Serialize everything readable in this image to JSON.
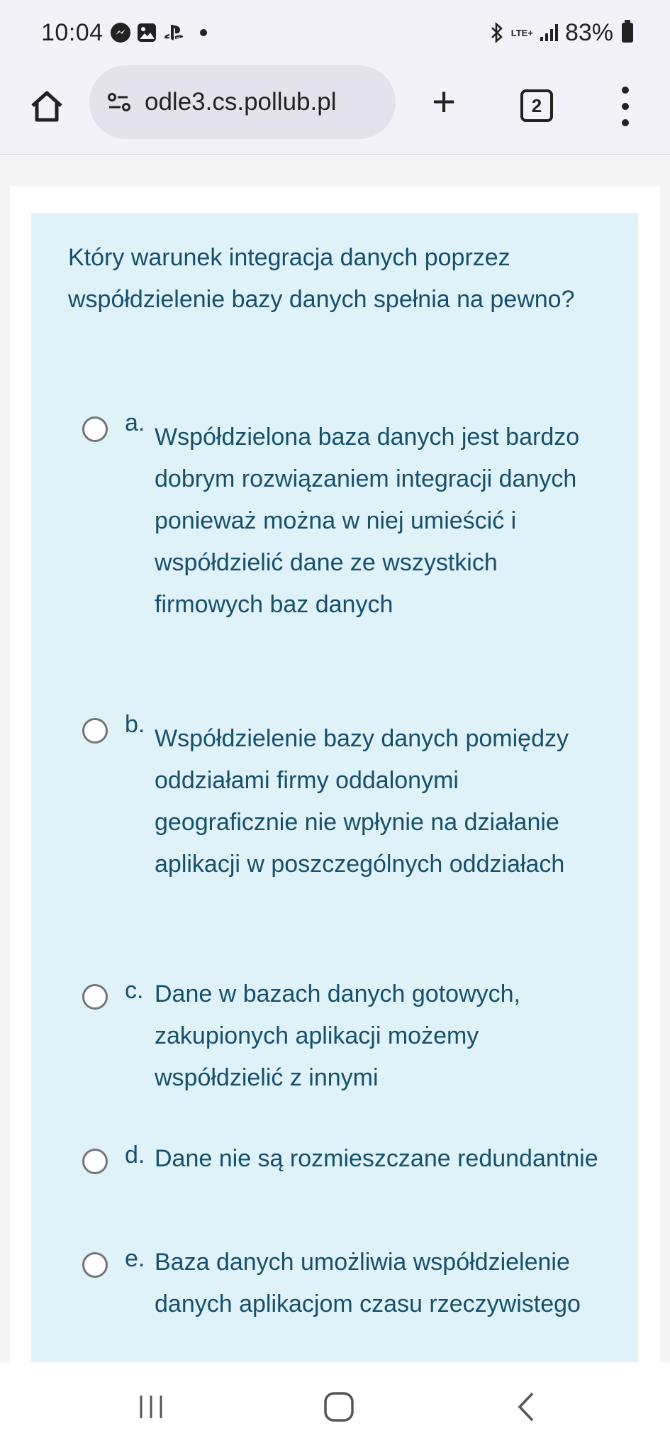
{
  "status_bar": {
    "time": "10:04",
    "network": "LTE+",
    "battery": "83%",
    "icons": [
      "messenger-icon",
      "gallery-icon",
      "playstation-icon",
      "notification-dot-icon",
      "bluetooth-icon",
      "lte-icon",
      "signal-icon",
      "battery-icon"
    ]
  },
  "browser": {
    "url": "odle3.cs.pollub.pl",
    "tab_count": "2",
    "icons": [
      "home-icon",
      "site-settings-icon",
      "new-tab-icon",
      "tabs-icon",
      "menu-icon"
    ]
  },
  "question": {
    "text": "Który warunek integracja danych poprzez współdzielenie bazy danych spełnia na pewno?",
    "answers": [
      {
        "letter": "a.",
        "text": "Współdzielona baza danych jest bardzo dobrym rozwiązaniem integracji danych ponieważ można w niej umieścić i współdzielić dane ze wszystkich firmowych baz danych",
        "selected": false
      },
      {
        "letter": "b.",
        "text": "Współdzielenie bazy danych pomiędzy oddziałami firmy oddalonymi geograficznie nie wpłynie na działanie aplikacji  w poszczególnych oddziałach",
        "selected": false
      },
      {
        "letter": "c.",
        "text": "Dane w bazach danych gotowych, zakupionych aplikacji możemy współdzielić z innymi",
        "selected": false
      },
      {
        "letter": "d.",
        "text": "Dane nie są rozmieszczane redundantnie",
        "selected": false
      },
      {
        "letter": "e.",
        "text": "Baza danych umożliwia współdzielenie danych aplikacjom czasu rzeczywistego",
        "selected": false
      }
    ]
  },
  "navbar": {
    "icons": [
      "recent-apps-icon",
      "home-nav-icon",
      "back-icon"
    ]
  },
  "colors": {
    "question_bg": "#def2f8",
    "question_text": "#17506b",
    "chrome_bg": "#f3f2f8",
    "url_bar_bg": "#e4e3ec"
  }
}
